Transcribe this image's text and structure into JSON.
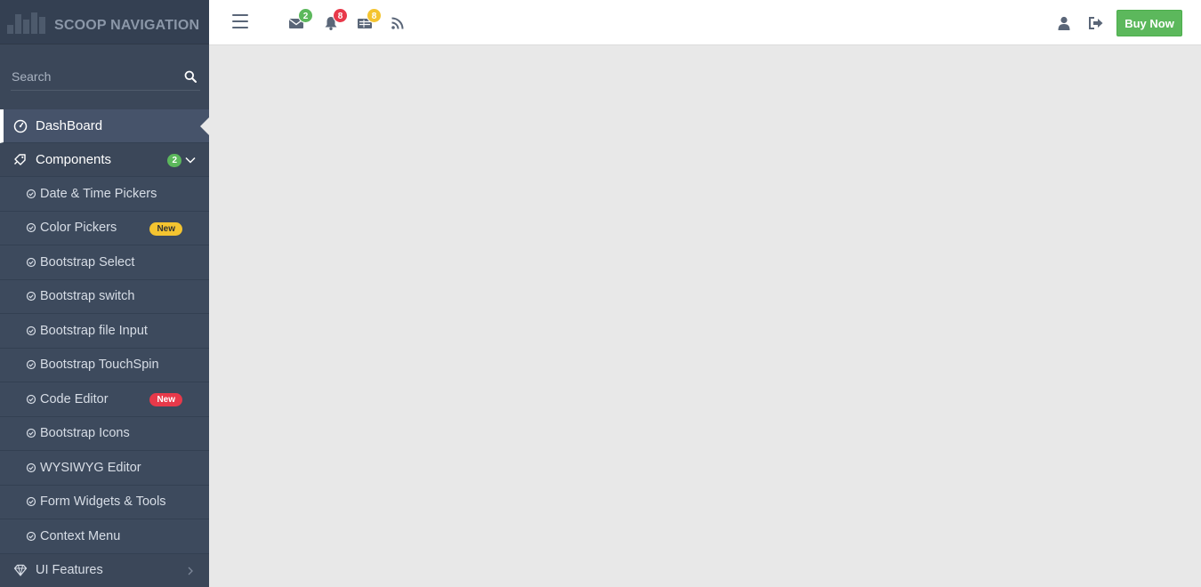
{
  "brand": {
    "title": "SCOOP NAVIGATION",
    "icon": "bar-chart-logo"
  },
  "search": {
    "placeholder": "Search",
    "value": ""
  },
  "nav": {
    "dashboard": {
      "label": "DashBoard",
      "icon": "dashboard-icon"
    },
    "components": {
      "label": "Components",
      "icon": "tag-icon",
      "count": "2",
      "items": [
        {
          "label": "Date & Time Pickers"
        },
        {
          "label": "Color Pickers",
          "badge": "New",
          "badge_color": "#f4c430"
        },
        {
          "label": "Bootstrap Select"
        },
        {
          "label": "Bootstrap switch"
        },
        {
          "label": "Bootstrap file Input"
        },
        {
          "label": "Bootstrap TouchSpin"
        },
        {
          "label": "Code Editor",
          "badge": "New",
          "badge_color": "#e8394a"
        },
        {
          "label": "Bootstrap Icons"
        },
        {
          "label": "WYSIWYG Editor"
        },
        {
          "label": "Form Widgets & Tools"
        },
        {
          "label": "Context Menu"
        }
      ]
    },
    "ui_features": {
      "label": "UI Features",
      "icon": "diamond-icon"
    }
  },
  "topbar": {
    "messages_count": "2",
    "notifications_count": "8",
    "tasks_count": "8",
    "buy_label": "Buy Now"
  },
  "colors": {
    "sidebar_bg": "#3b4759",
    "accent_green": "#5cb85c",
    "badge_red": "#e8394a",
    "badge_yellow": "#f4c430",
    "content_bg": "#e8e8e8"
  }
}
